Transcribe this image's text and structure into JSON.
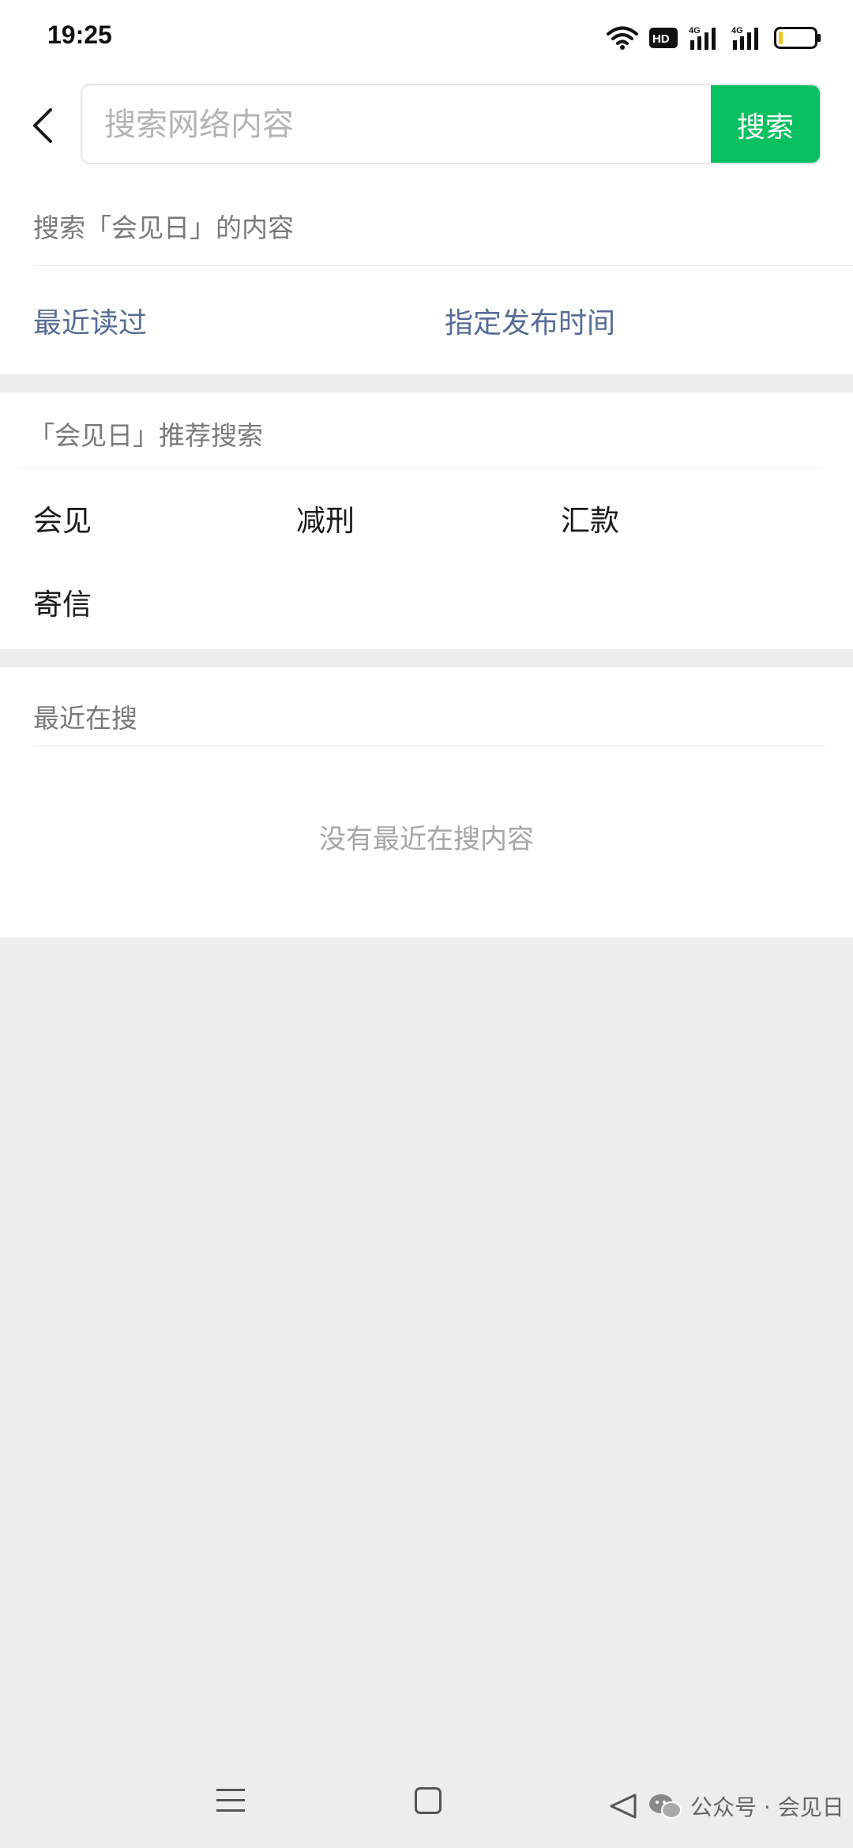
{
  "status_bar": {
    "time": "19:25",
    "icons": [
      "wifi-icon",
      "hd-voice-icon",
      "signal-4g-icon",
      "signal-4g-icon",
      "battery-low-icon"
    ],
    "hd_label": "HD",
    "network_label": "4G",
    "battery_color": "#f5c518"
  },
  "header": {
    "back_icon": "chevron-left-icon",
    "search_placeholder": "搜索网络内容",
    "search_value": "",
    "search_button": "搜索",
    "accent_color": "#07c160"
  },
  "section_search_scope": {
    "title": "搜索「会见日」的内容",
    "filters": [
      "最近读过",
      "指定发布时间"
    ],
    "link_color": "#576b95"
  },
  "section_recommended": {
    "title": "「会见日」推荐搜索",
    "keywords": [
      "会见",
      "减刑",
      "汇款",
      "寄信"
    ]
  },
  "section_recent": {
    "title": "最近在搜",
    "empty_text": "没有最近在搜内容"
  },
  "bottom_nav": {
    "icons": [
      "menu-icon",
      "home-icon",
      "back-icon"
    ]
  },
  "watermark": {
    "text": "公众号 · 会见日",
    "icon": "wechat-icon"
  }
}
